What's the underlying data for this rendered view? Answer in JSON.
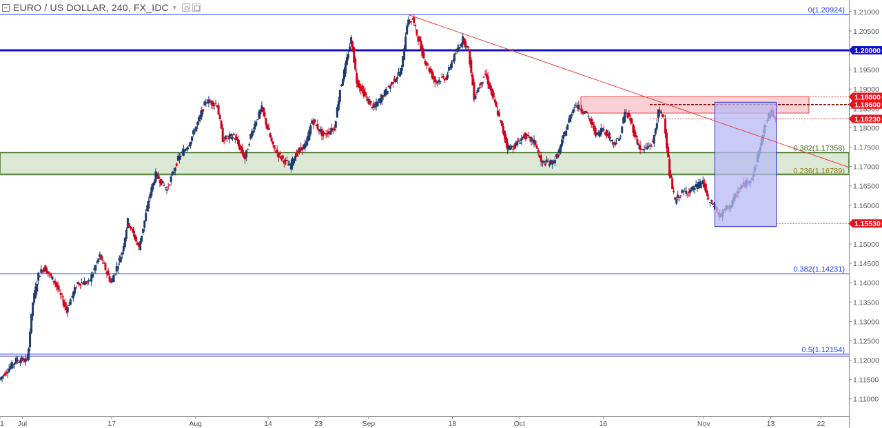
{
  "header": {
    "title": "EURO / US DOLLAR, 240, FX_IDC"
  },
  "colors": {
    "up_candle": "#1f3a6e",
    "down_candle": "#d0021b",
    "fib_line": "#1a3cff",
    "level_line": "#1010c8",
    "trendline": "#e84040",
    "green_zone": "#dbe9d6",
    "red_zone": "#f8c8cc",
    "blue_box": "#b7b9f3",
    "price_tag_red": "#e8141c",
    "price_tag_blue": "#1010c8"
  },
  "chart_data": {
    "type": "candlestick",
    "symbol": "EURO / US DOLLAR",
    "interval": "240",
    "source": "FX_IDC",
    "ylim": [
      1.1055,
      1.213
    ],
    "y_ticks": [
      "1.21000",
      "1.20500",
      "1.19500",
      "1.19000",
      "1.18500",
      "1.18000",
      "1.17500",
      "1.17000",
      "1.16500",
      "1.16000",
      "1.15500",
      "1.15000",
      "1.14500",
      "1.14000",
      "1.13500",
      "1.13000",
      "1.12500",
      "1.12000",
      "1.11500",
      "1.11000"
    ],
    "x_ticks": [
      {
        "label": "1",
        "t": 0
      },
      {
        "label": "Jul",
        "t": 4
      },
      {
        "label": "17",
        "t": 20
      },
      {
        "label": "Aug",
        "t": 35
      },
      {
        "label": "14",
        "t": 48
      },
      {
        "label": "23",
        "t": 57
      },
      {
        "label": "Sep",
        "t": 66
      },
      {
        "label": "18",
        "t": 81
      },
      {
        "label": "Oct",
        "t": 93
      },
      {
        "label": "16",
        "t": 108
      },
      {
        "label": "Nov",
        "t": 126
      },
      {
        "label": "13",
        "t": 138
      },
      {
        "label": "22",
        "t": 147
      }
    ],
    "t_range": [
      0,
      152
    ],
    "price_path": [
      [
        0,
        1.115
      ],
      [
        3,
        1.12
      ],
      [
        5,
        1.12
      ],
      [
        6,
        1.135
      ],
      [
        7,
        1.142
      ],
      [
        8,
        1.144
      ],
      [
        10,
        1.14
      ],
      [
        12,
        1.133
      ],
      [
        14,
        1.14
      ],
      [
        16,
        1.14
      ],
      [
        18,
        1.147
      ],
      [
        20,
        1.14
      ],
      [
        22,
        1.148
      ],
      [
        23,
        1.156
      ],
      [
        25,
        1.149
      ],
      [
        27,
        1.163
      ],
      [
        28,
        1.168
      ],
      [
        30,
        1.164
      ],
      [
        32,
        1.172
      ],
      [
        34,
        1.176
      ],
      [
        36,
        1.183
      ],
      [
        37,
        1.187
      ],
      [
        39,
        1.186
      ],
      [
        40,
        1.177
      ],
      [
        42,
        1.178
      ],
      [
        44,
        1.172
      ],
      [
        45,
        1.178
      ],
      [
        46,
        1.182
      ],
      [
        47,
        1.185
      ],
      [
        49,
        1.175
      ],
      [
        50,
        1.173
      ],
      [
        52,
        1.17
      ],
      [
        53,
        1.173
      ],
      [
        55,
        1.176
      ],
      [
        56,
        1.182
      ],
      [
        58,
        1.178
      ],
      [
        60,
        1.18
      ],
      [
        61,
        1.19
      ],
      [
        62,
        1.196
      ],
      [
        63,
        1.203
      ],
      [
        64,
        1.192
      ],
      [
        66,
        1.187
      ],
      [
        67,
        1.185
      ],
      [
        69,
        1.189
      ],
      [
        70,
        1.191
      ],
      [
        72,
        1.195
      ],
      [
        73,
        1.207
      ],
      [
        74,
        1.208
      ],
      [
        76,
        1.198
      ],
      [
        78,
        1.192
      ],
      [
        80,
        1.193
      ],
      [
        81,
        1.197
      ],
      [
        82,
        1.2
      ],
      [
        83,
        1.203
      ],
      [
        84,
        1.2
      ],
      [
        85,
        1.188
      ],
      [
        87,
        1.194
      ],
      [
        89,
        1.185
      ],
      [
        90,
        1.18
      ],
      [
        91,
        1.175
      ],
      [
        92,
        1.175
      ],
      [
        94,
        1.178
      ],
      [
        96,
        1.176
      ],
      [
        97,
        1.171
      ],
      [
        99,
        1.171
      ],
      [
        100,
        1.173
      ],
      [
        102,
        1.182
      ],
      [
        103,
        1.186
      ],
      [
        105,
        1.184
      ],
      [
        106,
        1.181
      ],
      [
        107,
        1.178
      ],
      [
        108,
        1.18
      ],
      [
        110,
        1.176
      ],
      [
        111,
        1.177
      ],
      [
        112,
        1.184
      ],
      [
        113,
        1.182
      ],
      [
        114,
        1.177
      ],
      [
        115,
        1.174
      ],
      [
        117,
        1.176
      ],
      [
        118,
        1.184
      ],
      [
        119,
        1.183
      ],
      [
        120,
        1.168
      ],
      [
        121,
        1.161
      ],
      [
        122,
        1.163
      ],
      [
        124,
        1.164
      ],
      [
        126,
        1.166
      ],
      [
        127,
        1.161
      ],
      [
        128,
        1.16
      ],
      [
        129,
        1.157
      ],
      [
        130,
        1.159
      ],
      [
        131,
        1.16
      ],
      [
        132,
        1.163
      ],
      [
        133,
        1.165
      ],
      [
        134,
        1.166
      ],
      [
        135,
        1.168
      ],
      [
        136,
        1.174
      ],
      [
        137,
        1.18
      ],
      [
        138,
        1.184
      ],
      [
        139,
        1.183
      ]
    ],
    "horizontal_lines": [
      {
        "price": 1.20924,
        "label": "0(1.20924)",
        "style": "fib"
      },
      {
        "price": 1.2,
        "label": "1.20000",
        "style": "level"
      },
      {
        "price": 1.14231,
        "label": "0.382(1.14231)",
        "style": "fib"
      },
      {
        "price": 1.12154,
        "label": "0.5(1.12154)",
        "style": "fib"
      }
    ],
    "zones": [
      {
        "kind": "green",
        "from": 1.16789,
        "to": 1.17358,
        "top_label": "0.382(1.17358)",
        "bottom_label": "0.236(1.16789)"
      },
      {
        "kind": "red",
        "from": 1.1838,
        "to": 1.188,
        "t_start": 104,
        "t_end": 152
      }
    ],
    "blue_box": {
      "t_start": 128,
      "t_end": 139,
      "from": 1.1545,
      "to": 1.1866
    },
    "trendline": {
      "t1": 73,
      "p1": 1.20924,
      "t2": 152,
      "p2": 1.1698
    },
    "dotted_levels": [
      1.188,
      1.186,
      1.1823,
      1.1553
    ],
    "price_tags": [
      {
        "price": 1.2,
        "label": "1.20000",
        "color": "blue"
      },
      {
        "price": 1.188,
        "label": "1.18800",
        "color": "red"
      },
      {
        "price": 1.186,
        "label": "1.18600",
        "color": "red"
      },
      {
        "price": 1.1823,
        "label": "1.18230",
        "color": "red"
      },
      {
        "price": 1.1553,
        "label": "1.15530",
        "color": "red"
      }
    ]
  }
}
